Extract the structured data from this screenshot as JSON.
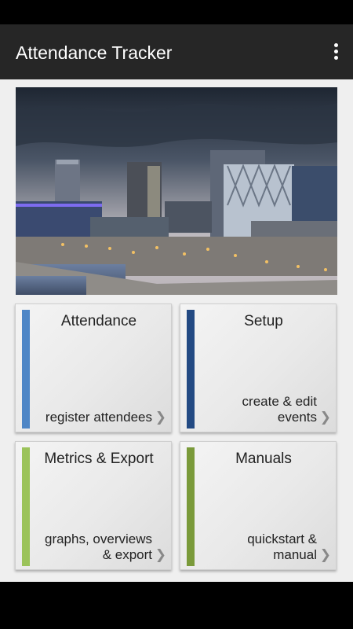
{
  "app_bar": {
    "title": "Attendance Tracker",
    "menu_icon": "overflow-menu-icon"
  },
  "hero": {
    "image": "city-skyline-photo",
    "colors": {
      "sky_top": "#1e2632",
      "sky_bottom": "#c9c4c8",
      "water": "#5b6f8e"
    }
  },
  "tiles": [
    {
      "title": "Attendance",
      "subtitle": [
        "register attendees"
      ],
      "accent": "#4e86c6",
      "chevron": "❯"
    },
    {
      "title": "Setup",
      "subtitle": [
        "create & edit",
        "events"
      ],
      "accent": "#234a83",
      "chevron": "❯"
    },
    {
      "title": "Metrics & Export",
      "subtitle": [
        "graphs, overviews",
        "& export"
      ],
      "accent": "#9bc35a",
      "chevron": "❯"
    },
    {
      "title": "Manuals",
      "subtitle": [
        "quickstart &",
        "manual"
      ],
      "accent": "#7a9a3a",
      "chevron": "❯"
    }
  ]
}
